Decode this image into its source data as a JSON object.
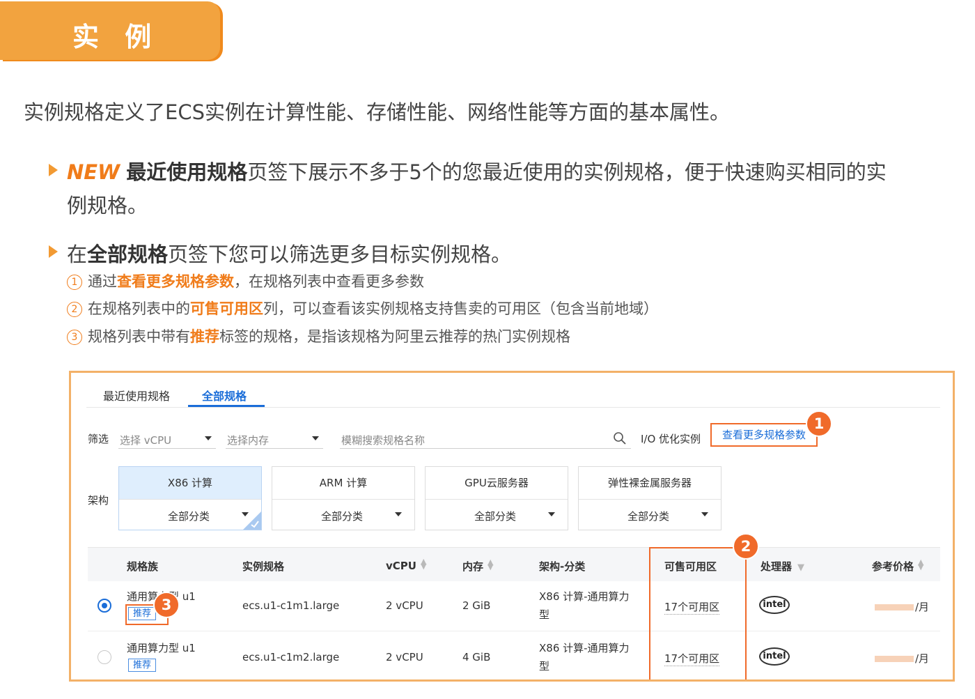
{
  "header": {
    "title": "实 例"
  },
  "intro": "实例规格定义了ECS实例在计算性能、存储性能、网络性能等方面的基本属性。",
  "bullet1": {
    "new": "NEW",
    "strong": "最近使用规格",
    "rest": "页签下展示不多于5个的您最近使用的实例规格，便于快速购买相同的实",
    "line2": "例规格。"
  },
  "bullet2": {
    "pre": "在",
    "strong": "全部规格",
    "rest": "页签下您可以筛选更多目标实例规格。"
  },
  "subs": [
    {
      "num": "1",
      "pre": "通过",
      "hl": "查看更多规格参数",
      "post": "，在规格列表中查看更多参数"
    },
    {
      "num": "2",
      "pre": "在规格列表中的",
      "hl": "可售可用区",
      "post": "列，可以查看该实例规格支持售卖的可用区（包含当前地域）"
    },
    {
      "num": "3",
      "pre": "规格列表中带有",
      "hl": "推荐",
      "post": "标签的规格，是指该规格为阿里云推荐的热门实例规格"
    }
  ],
  "panel": {
    "tabs": [
      "最近使用规格",
      "全部规格"
    ],
    "filter_label": "筛选",
    "vcpu_select": "选择 vCPU",
    "mem_select": "选择内存",
    "search_placeholder": "模糊搜索规格名称",
    "io_label": "I/O 优化实例",
    "more_params": "查看更多规格参数",
    "arch_label": "架构",
    "arch_cards": [
      {
        "title": "X86 计算",
        "sub": "全部分类"
      },
      {
        "title": "ARM 计算",
        "sub": "全部分类"
      },
      {
        "title": "GPU云服务器",
        "sub": "全部分类"
      },
      {
        "title": "弹性裸金属服务器",
        "sub": "全部分类"
      }
    ],
    "badges": [
      "1",
      "2",
      "3"
    ],
    "columns": [
      "规格族",
      "实例规格",
      "vCPU",
      "内存",
      "架构-分类",
      "可售可用区",
      "处理器",
      "参考价格"
    ],
    "rows": [
      {
        "family": "通用算力型 u1",
        "tag": "推荐",
        "spec": "ecs.u1-c1m1.large",
        "vcpu": "2 vCPU",
        "mem": "2 GiB",
        "arch1": "X86 计算-通用算力",
        "arch2": "型",
        "zones": "17个可用区",
        "cpu": "intel",
        "price_unit": "/月",
        "selected": true
      },
      {
        "family": "通用算力型 u1",
        "tag": "推荐",
        "spec": "ecs.u1-c1m2.large",
        "vcpu": "2 vCPU",
        "mem": "4 GiB",
        "arch1": "X86 计算-通用算力",
        "arch2": "型",
        "zones": "17个可用区",
        "cpu": "intel",
        "price_unit": "/月",
        "selected": false
      }
    ]
  }
}
